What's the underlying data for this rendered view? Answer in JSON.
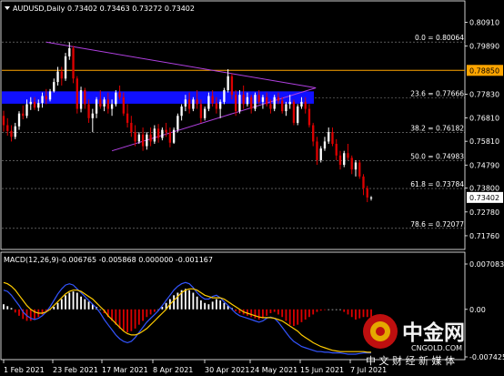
{
  "header": {
    "symbol_text": "AUDUSD,Daily",
    "ohlc_text": "0.73402 0.73463 0.73272 0.73402"
  },
  "macd_header": {
    "label": "MACD(12,26,9)",
    "values_text": "-0.006765 -0.005868 0.000000 -0.001167"
  },
  "colors": {
    "background": "#000000",
    "bull": "#ffffff",
    "bear": "#dd0000",
    "triangle": "#b040e0",
    "orange_line": "#ffa500",
    "blue_band": "#1010ff",
    "macd_line": "#3355ff",
    "signal_line": "#ffcc00",
    "macd_hist_pos": "#ffffff",
    "macd_hist_neg": "#dd0000",
    "price_tag_bg": "#ffffff",
    "orange_tag_bg": "#ffa500"
  },
  "price_axis": {
    "labels": [
      "0.80910",
      "0.79890",
      "0.78850",
      "0.77830",
      "0.76810",
      "0.75810",
      "0.74790",
      "0.73800",
      "0.72780",
      "0.71760"
    ],
    "current_price": "0.73402",
    "orange_level_label": "0.78850"
  },
  "macd_axis": {
    "labels": [
      "0.007083",
      "0.00",
      "-0.007425"
    ]
  },
  "x_axis": {
    "labels": [
      "1 Feb 2021",
      "23 Feb 2021",
      "17 Mar 2021",
      "8 Apr 2021",
      "30 Apr 2021",
      "24 May 2021",
      "15 Jun 2021",
      "7 Jul 2021"
    ]
  },
  "fib_levels": [
    {
      "label": "0.0 = 0.80064",
      "price": 0.80064
    },
    {
      "label": "23.6 = 0.77666",
      "price": 0.77666
    },
    {
      "label": "38.2 = 0.76182",
      "price": 0.76182
    },
    {
      "label": "50.0 = 0.74983",
      "price": 0.74983
    },
    {
      "label": "61.8 = 0.73784",
      "price": 0.73784
    },
    {
      "label": "78.6 = 0.72077",
      "price": 0.72077
    }
  ],
  "levels": {
    "orange": 0.7885,
    "blue_band": [
      0.7742,
      0.7795
    ]
  },
  "watermark": {
    "cn_name": "中金网",
    "domain": "CNGOLD.COM",
    "tagline": "中 文 财 经 新 媒 体"
  },
  "chart_data": {
    "type": "candlestick",
    "title": "AUDUSD,Daily",
    "ylim": [
      0.7125,
      0.8132
    ],
    "series": [
      {
        "name": "price",
        "ohlc": [
          [
            0.769,
            0.7712,
            0.7622,
            0.765
          ],
          [
            0.765,
            0.768,
            0.7605,
            0.7625
          ],
          [
            0.7625,
            0.765,
            0.758,
            0.76
          ],
          [
            0.76,
            0.766,
            0.759,
            0.7645
          ],
          [
            0.7645,
            0.771,
            0.763,
            0.77
          ],
          [
            0.77,
            0.7735,
            0.7675,
            0.769
          ],
          [
            0.769,
            0.776,
            0.768,
            0.774
          ],
          [
            0.774,
            0.777,
            0.7715,
            0.775
          ],
          [
            0.775,
            0.777,
            0.7715,
            0.7725
          ],
          [
            0.7725,
            0.776,
            0.771,
            0.7745
          ],
          [
            0.7745,
            0.779,
            0.7725,
            0.7775
          ],
          [
            0.7775,
            0.7805,
            0.774,
            0.776
          ],
          [
            0.776,
            0.7805,
            0.7752,
            0.7795
          ],
          [
            0.7795,
            0.785,
            0.779,
            0.7835
          ],
          [
            0.7835,
            0.79,
            0.782,
            0.788
          ],
          [
            0.788,
            0.79,
            0.782,
            0.785
          ],
          [
            0.785,
            0.796,
            0.784,
            0.7945
          ],
          [
            0.7945,
            0.8006,
            0.793,
            0.798
          ],
          [
            0.798,
            0.799,
            0.783,
            0.785
          ],
          [
            0.785,
            0.786,
            0.77,
            0.772
          ],
          [
            0.772,
            0.7815,
            0.7705,
            0.78
          ],
          [
            0.78,
            0.781,
            0.772,
            0.774
          ],
          [
            0.774,
            0.776,
            0.766,
            0.768
          ],
          [
            0.768,
            0.772,
            0.762,
            0.77
          ],
          [
            0.77,
            0.777,
            0.768,
            0.776
          ],
          [
            0.776,
            0.78,
            0.772,
            0.773
          ],
          [
            0.773,
            0.777,
            0.771,
            0.776
          ],
          [
            0.776,
            0.779,
            0.77,
            0.772
          ],
          [
            0.772,
            0.776,
            0.769,
            0.774
          ],
          [
            0.774,
            0.78,
            0.773,
            0.779
          ],
          [
            0.779,
            0.782,
            0.776,
            0.777
          ],
          [
            0.777,
            0.779,
            0.769,
            0.77
          ],
          [
            0.77,
            0.774,
            0.764,
            0.766
          ],
          [
            0.766,
            0.769,
            0.76,
            0.762
          ],
          [
            0.762,
            0.765,
            0.756,
            0.758
          ],
          [
            0.758,
            0.762,
            0.757,
            0.761
          ],
          [
            0.761,
            0.764,
            0.754,
            0.756
          ],
          [
            0.756,
            0.762,
            0.7545,
            0.761
          ],
          [
            0.761,
            0.764,
            0.756,
            0.758
          ],
          [
            0.758,
            0.765,
            0.757,
            0.7635
          ],
          [
            0.7635,
            0.7655,
            0.7575,
            0.7595
          ],
          [
            0.7595,
            0.764,
            0.7585,
            0.763
          ],
          [
            0.763,
            0.766,
            0.76,
            0.762
          ],
          [
            0.762,
            0.764,
            0.7555,
            0.7575
          ],
          [
            0.7575,
            0.764,
            0.757,
            0.763
          ],
          [
            0.763,
            0.77,
            0.762,
            0.769
          ],
          [
            0.769,
            0.774,
            0.767,
            0.773
          ],
          [
            0.773,
            0.778,
            0.771,
            0.776
          ],
          [
            0.776,
            0.779,
            0.77,
            0.772
          ],
          [
            0.772,
            0.777,
            0.771,
            0.776
          ],
          [
            0.776,
            0.78,
            0.772,
            0.774
          ],
          [
            0.774,
            0.776,
            0.766,
            0.768
          ],
          [
            0.768,
            0.773,
            0.767,
            0.772
          ],
          [
            0.772,
            0.779,
            0.771,
            0.7775
          ],
          [
            0.7775,
            0.78,
            0.773,
            0.7745
          ],
          [
            0.7745,
            0.777,
            0.77,
            0.772
          ],
          [
            0.772,
            0.776,
            0.768,
            0.775
          ],
          [
            0.775,
            0.781,
            0.774,
            0.78
          ],
          [
            0.78,
            0.789,
            0.779,
            0.786
          ],
          [
            0.786,
            0.787,
            0.776,
            0.778
          ],
          [
            0.778,
            0.78,
            0.769,
            0.771
          ],
          [
            0.771,
            0.78,
            0.77,
            0.778
          ],
          [
            0.778,
            0.782,
            0.772,
            0.774
          ],
          [
            0.774,
            0.779,
            0.773,
            0.777
          ],
          [
            0.777,
            0.778,
            0.77,
            0.772
          ],
          [
            0.772,
            0.779,
            0.771,
            0.778
          ],
          [
            0.778,
            0.78,
            0.774,
            0.775
          ],
          [
            0.775,
            0.778,
            0.772,
            0.777
          ],
          [
            0.777,
            0.779,
            0.773,
            0.774
          ],
          [
            0.774,
            0.776,
            0.77,
            0.772
          ],
          [
            0.772,
            0.778,
            0.771,
            0.777
          ],
          [
            0.777,
            0.779,
            0.774,
            0.7755
          ],
          [
            0.7755,
            0.777,
            0.77,
            0.771
          ],
          [
            0.771,
            0.775,
            0.769,
            0.774
          ],
          [
            0.774,
            0.778,
            0.772,
            0.775
          ],
          [
            0.775,
            0.776,
            0.765,
            0.766
          ],
          [
            0.766,
            0.774,
            0.765,
            0.773
          ],
          [
            0.773,
            0.777,
            0.772,
            0.775
          ],
          [
            0.775,
            0.777,
            0.77,
            0.772
          ],
          [
            0.772,
            0.774,
            0.764,
            0.765
          ],
          [
            0.765,
            0.766,
            0.756,
            0.758
          ],
          [
            0.758,
            0.76,
            0.748,
            0.75
          ],
          [
            0.75,
            0.756,
            0.749,
            0.755
          ],
          [
            0.755,
            0.76,
            0.754,
            0.758
          ],
          [
            0.758,
            0.764,
            0.757,
            0.762
          ],
          [
            0.762,
            0.764,
            0.756,
            0.757
          ],
          [
            0.757,
            0.759,
            0.75,
            0.752
          ],
          [
            0.752,
            0.754,
            0.746,
            0.748
          ],
          [
            0.748,
            0.754,
            0.747,
            0.753
          ],
          [
            0.753,
            0.757,
            0.75,
            0.751
          ],
          [
            0.751,
            0.752,
            0.744,
            0.746
          ],
          [
            0.746,
            0.75,
            0.743,
            0.749
          ],
          [
            0.749,
            0.75,
            0.742,
            0.743
          ],
          [
            0.743,
            0.744,
            0.735,
            0.738
          ],
          [
            0.738,
            0.739,
            0.732,
            0.734
          ],
          [
            0.734,
            0.7346,
            0.7327,
            0.734
          ]
        ]
      }
    ],
    "macd": {
      "hist": [
        0.0008,
        0.0005,
        0.0002,
        -0.0005,
        -0.001,
        -0.0015,
        -0.0018,
        -0.0018,
        -0.0016,
        -0.0012,
        -0.0008,
        -0.0004,
        0.0,
        0.0004,
        0.001,
        0.0016,
        0.0022,
        0.0026,
        0.0028,
        0.0026,
        0.002,
        0.0016,
        0.0012,
        0.0008,
        0.0004,
        0.0,
        -0.0006,
        -0.0012,
        -0.0018,
        -0.0024,
        -0.003,
        -0.0034,
        -0.0036,
        -0.0034,
        -0.003,
        -0.0024,
        -0.0018,
        -0.0012,
        -0.0008,
        -0.0004,
        0.0,
        0.0004,
        0.001,
        0.0016,
        0.0022,
        0.0026,
        0.003,
        0.0032,
        0.003,
        0.0026,
        0.002,
        0.0014,
        0.001,
        0.0008,
        0.0012,
        0.0016,
        0.0014,
        0.001,
        0.0006,
        0.0002,
        -0.0003,
        -0.0006,
        -0.0008,
        -0.001,
        -0.0012,
        -0.0014,
        -0.0016,
        -0.0014,
        -0.001,
        -0.0006,
        -0.0004,
        -0.0008,
        -0.0012,
        -0.0018,
        -0.0024,
        -0.0026,
        -0.0024,
        -0.002,
        -0.0016,
        -0.0012,
        -0.0008,
        -0.0004,
        -0.0002,
        -0.0001,
        0.0,
        0.0,
        0.0,
        0.0,
        -0.0004,
        -0.0008,
        -0.0012,
        -0.0016,
        -0.0014,
        -0.0012,
        -0.0012,
        -0.0012
      ],
      "macd_line": [
        0.003,
        0.0028,
        0.0022,
        0.0014,
        0.0006,
        -0.0004,
        -0.001,
        -0.0014,
        -0.0016,
        -0.0014,
        -0.001,
        -0.0004,
        0.0004,
        0.0014,
        0.0024,
        0.0032,
        0.0038,
        0.004,
        0.0038,
        0.0032,
        0.0026,
        0.002,
        0.0014,
        0.0008,
        0.0002,
        -0.0006,
        -0.0016,
        -0.0024,
        -0.0032,
        -0.004,
        -0.0046,
        -0.005,
        -0.0052,
        -0.005,
        -0.0044,
        -0.0036,
        -0.0028,
        -0.002,
        -0.0014,
        -0.0008,
        -0.0002,
        0.0006,
        0.0014,
        0.0022,
        0.003,
        0.0036,
        0.004,
        0.0042,
        0.004,
        0.0034,
        0.0026,
        0.002,
        0.0016,
        0.0016,
        0.002,
        0.0022,
        0.0018,
        0.0012,
        0.0006,
        0.0,
        -0.0006,
        -0.001,
        -0.0012,
        -0.0014,
        -0.0016,
        -0.0018,
        -0.002,
        -0.0018,
        -0.0014,
        -0.0012,
        -0.0014,
        -0.002,
        -0.0028,
        -0.0036,
        -0.0044,
        -0.005,
        -0.0054,
        -0.0058,
        -0.006,
        -0.0062,
        -0.0064,
        -0.0066,
        -0.0066,
        -0.0067,
        -0.0067,
        -0.0068,
        -0.0068,
        -0.0068,
        -0.0069,
        -0.007,
        -0.007,
        -0.007,
        -0.0069,
        -0.0068,
        -0.0068,
        -0.0068
      ],
      "signal_line": [
        0.0042,
        0.004,
        0.0036,
        0.003,
        0.0022,
        0.0014,
        0.0006,
        0.0,
        -0.0004,
        -0.0006,
        -0.0006,
        -0.0004,
        0.0,
        0.0006,
        0.0012,
        0.0018,
        0.0024,
        0.0028,
        0.003,
        0.003,
        0.0028,
        0.0024,
        0.002,
        0.0016,
        0.001,
        0.0004,
        -0.0002,
        -0.001,
        -0.0016,
        -0.0022,
        -0.0028,
        -0.0034,
        -0.0038,
        -0.004,
        -0.004,
        -0.0038,
        -0.0034,
        -0.003,
        -0.0024,
        -0.0018,
        -0.0012,
        -0.0006,
        0.0,
        0.0008,
        0.0014,
        0.002,
        0.0026,
        0.003,
        0.0032,
        0.0032,
        0.003,
        0.0026,
        0.0022,
        0.002,
        0.0018,
        0.0018,
        0.0018,
        0.0016,
        0.0012,
        0.0008,
        0.0004,
        0.0,
        -0.0004,
        -0.0006,
        -0.0008,
        -0.001,
        -0.0012,
        -0.0013,
        -0.0013,
        -0.0013,
        -0.0014,
        -0.0016,
        -0.0018,
        -0.0022,
        -0.0026,
        -0.003,
        -0.0034,
        -0.004,
        -0.0044,
        -0.0048,
        -0.0052,
        -0.0055,
        -0.0058,
        -0.006,
        -0.0062,
        -0.0064,
        -0.0065,
        -0.0066,
        -0.0066,
        -0.0066,
        -0.0066,
        -0.0066,
        -0.0066,
        -0.0066,
        -0.0067,
        -0.0067
      ]
    },
    "triangle": {
      "apex_bar": 60,
      "apex_price": 0.781,
      "top_bar": 11,
      "top_price": 0.8006,
      "bottom_bar": 28,
      "bottom_price": 0.754
    }
  }
}
